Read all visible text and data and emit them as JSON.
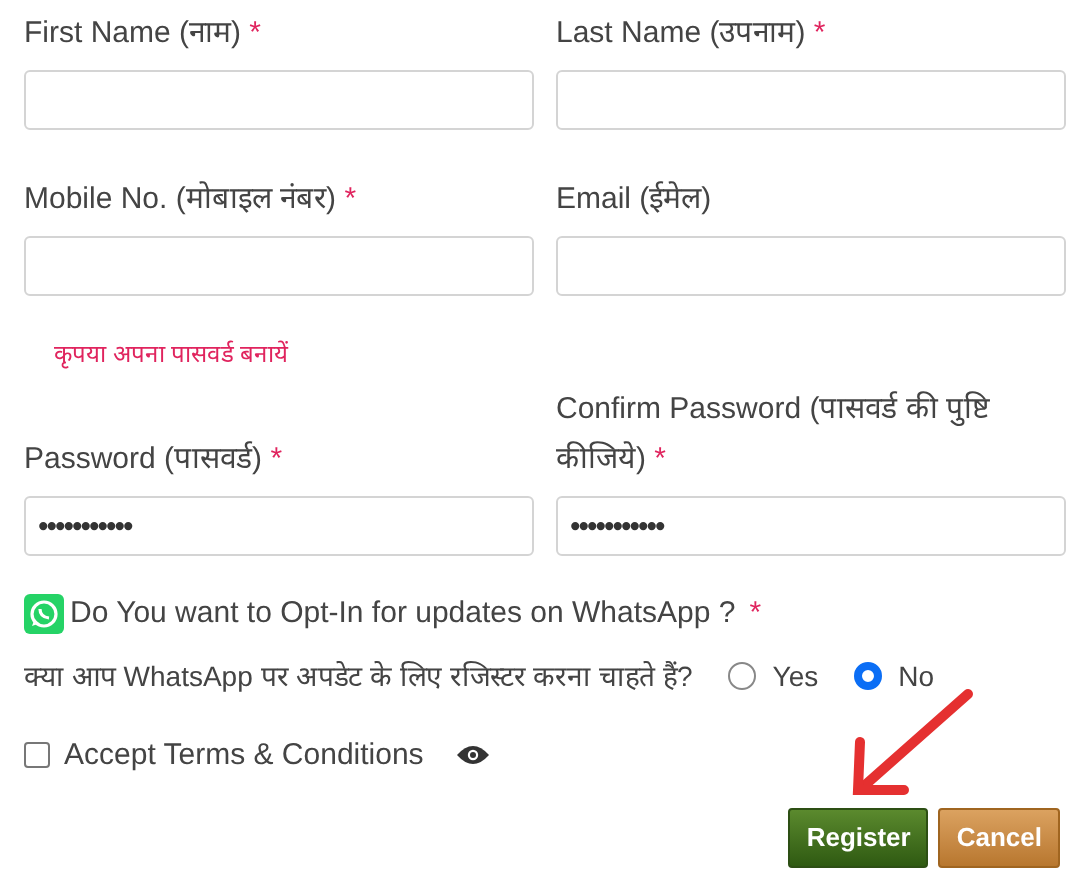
{
  "fields": [
    {
      "label": "First Name (नाम)",
      "required_mark": "*"
    },
    {
      "label": "Last Name (उपनाम)",
      "required_mark": "*"
    },
    {
      "label": "Mobile No. (मोबाइल नंबर)",
      "required_mark": "*"
    },
    {
      "label": "Email (ईमेल)"
    }
  ],
  "password_hint": "कृपया अपना पासवर्ड बनायें",
  "password_fields": [
    {
      "label": "Password (पासवर्ड)",
      "required_mark": "*",
      "value": "•••••••••••"
    },
    {
      "label": "Confirm Password (पासवर्ड की पुष्टि कीजिये)",
      "required_mark": "*",
      "value": "•••••••••••"
    }
  ],
  "whatsapp": {
    "question": "Do You want to Opt-In for updates on WhatsApp ?",
    "required_mark": "*",
    "question_hindi": "क्या आप WhatsApp पर अपडेट के लिए रजिस्टर करना चाहते हैं?",
    "options": [
      {
        "label": "Yes",
        "selected": false
      },
      {
        "label": "No",
        "selected": true
      }
    ]
  },
  "terms": {
    "label": "Accept Terms & Conditions",
    "checked": false
  },
  "buttons": [
    {
      "label": "Register",
      "kind": "primary"
    },
    {
      "label": "Cancel",
      "kind": "secondary"
    }
  ]
}
